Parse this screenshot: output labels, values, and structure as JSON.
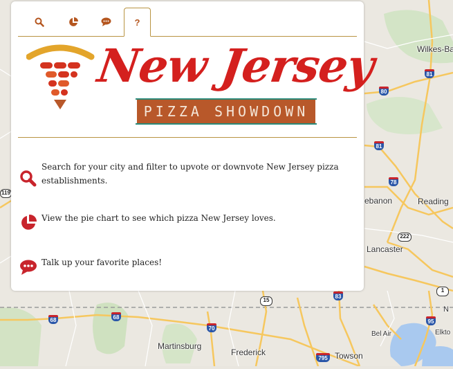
{
  "map": {
    "labels": {
      "wilkes_barre": "Wilkes-Bar",
      "lebanon": "ebanon",
      "reading": "Reading",
      "lancaster": "Lancaster",
      "martinsburg": "Martinsburg",
      "frederick": "Frederick",
      "towson": "Towson",
      "bel_air": "Bel Air",
      "elkton": "Elkto",
      "north_marker": "N"
    },
    "shields": {
      "i81_top": "81",
      "i80": "80",
      "i81_mid": "81",
      "us78": "78",
      "us222": "222",
      "us1": "1",
      "us15": "15",
      "i83": "83",
      "i68_left": "68",
      "us68": "68",
      "i70": "70",
      "i95": "95",
      "i795": "795",
      "i119": "119"
    }
  },
  "tabs": [
    {
      "name": "search",
      "icon": "search-icon"
    },
    {
      "name": "chart",
      "icon": "pie-chart-icon"
    },
    {
      "name": "comments",
      "icon": "comment-icon"
    },
    {
      "name": "help",
      "label": "?",
      "active": true
    }
  ],
  "logo": {
    "title": "New Jersey",
    "subtitle": "PIZZA SHOWDOWN",
    "icon": "pizza-slice-wifi-icon"
  },
  "help": [
    {
      "icon": "search-icon",
      "text": "Search for your city and filter to upvote or downvote New Jersey pizza establishments."
    },
    {
      "icon": "pie-chart-icon",
      "text": "View the pie chart to see which pizza New Jersey loves."
    },
    {
      "icon": "comment-icon",
      "text": "Talk up your favorite places!"
    }
  ],
  "colors": {
    "accent": "#b5561f",
    "brand_red": "#d4201e",
    "divider": "#b89341",
    "icon_red": "#c8242c"
  }
}
